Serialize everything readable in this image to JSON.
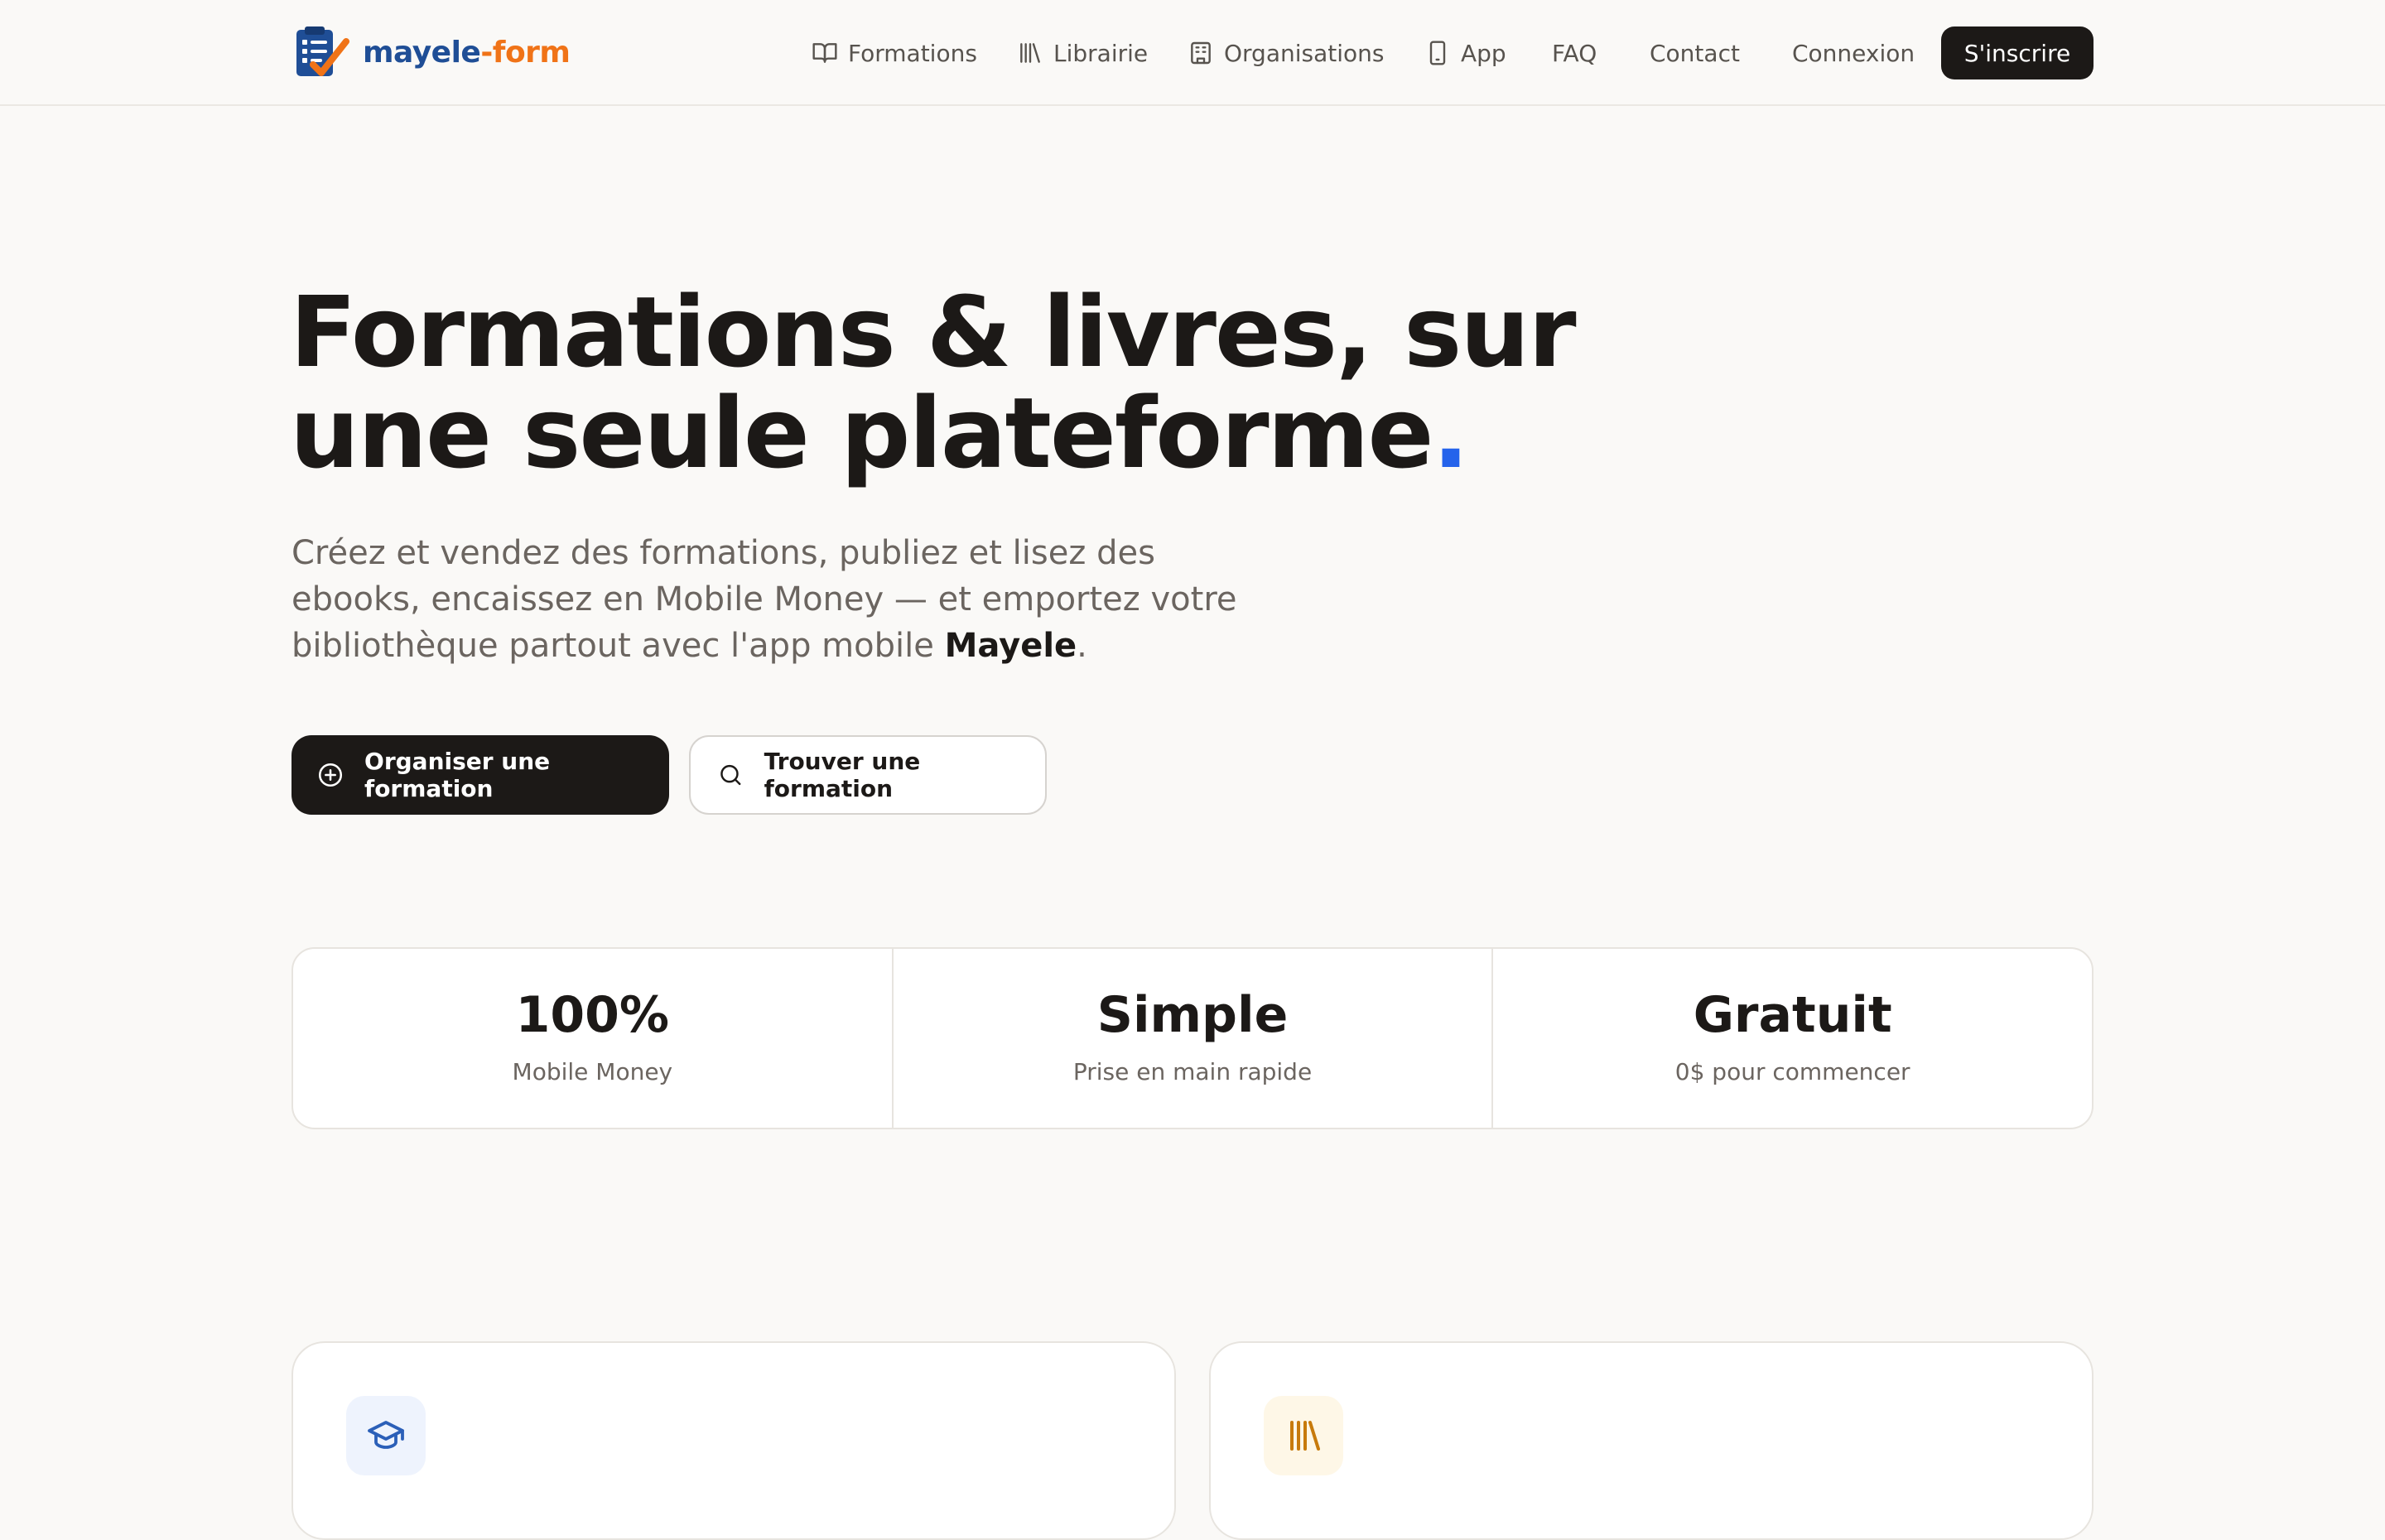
{
  "brand": {
    "name_part1": "mayele",
    "name_part2": "-form",
    "icon": "clipboard-check-icon",
    "colors": {
      "primary_blue": "#1f4e96",
      "accent_orange": "#f07317"
    }
  },
  "nav": {
    "items": [
      {
        "label": "Formations",
        "icon": "book-open-icon"
      },
      {
        "label": "Librairie",
        "icon": "library-icon"
      },
      {
        "label": "Organisations",
        "icon": "building-icon"
      },
      {
        "label": "App",
        "icon": "smartphone-icon"
      },
      {
        "label": "FAQ"
      },
      {
        "label": "Contact"
      },
      {
        "label": "Connexion"
      }
    ],
    "signup_label": "S'inscrire"
  },
  "hero": {
    "title": "Formations & livres, sur une seule plateforme",
    "title_dot": ".",
    "subtitle_before": "Créez et vendez des formations, publiez et lisez des ebooks, encaissez en Mobile Money — et emportez votre bibliothèque partout avec l'app mobile ",
    "subtitle_bold": "Mayele",
    "subtitle_after": ".",
    "cta_primary": {
      "label": "Organiser une formation",
      "icon": "plus-circle-icon"
    },
    "cta_secondary": {
      "label": "Trouver une formation",
      "icon": "search-icon"
    },
    "accent_color": "#2563eb"
  },
  "stats": [
    {
      "value": "100%",
      "label": "Mobile Money"
    },
    {
      "value": "Simple",
      "label": "Prise en main rapide"
    },
    {
      "value": "Gratuit",
      "label": "0$ pour commencer"
    }
  ],
  "features": [
    {
      "icon": "graduation-cap-icon",
      "color": "#2b5fb8"
    },
    {
      "icon": "library-icon",
      "color": "#c77a0c"
    }
  ]
}
